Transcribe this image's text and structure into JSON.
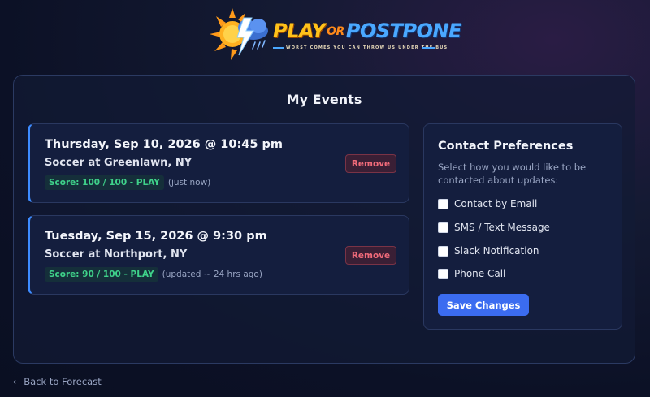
{
  "logo": {
    "play": "PLAY",
    "or": "OR",
    "postpone": "POSTPONE",
    "tagline": "WORST COMES YOU CAN THROW US UNDER THE BUS",
    "icon": "sun-storm-cloud-icon"
  },
  "page": {
    "title": "My Events"
  },
  "events": [
    {
      "date": "Thursday, Sep 10, 2026 @ 10:45 pm",
      "location": "Soccer at Greenlawn, NY",
      "score": "Score: 100 / 100 - PLAY",
      "updated": "(just now)",
      "remove_label": "Remove"
    },
    {
      "date": "Tuesday, Sep 15, 2026 @ 9:30 pm",
      "location": "Soccer at Northport, NY",
      "score": "Score: 90 / 100 - PLAY",
      "updated": "(updated ~ 24 hrs ago)",
      "remove_label": "Remove"
    }
  ],
  "contact": {
    "title": "Contact Preferences",
    "description": "Select how you would like to be contacted about updates:",
    "options": [
      {
        "label": "Contact by Email",
        "checked": false
      },
      {
        "label": "SMS / Text Message",
        "checked": false
      },
      {
        "label": "Slack Notification",
        "checked": false
      },
      {
        "label": "Phone Call",
        "checked": false
      }
    ],
    "save_label": "Save Changes"
  },
  "footer": {
    "back_label": "← Back to Forecast"
  },
  "colors": {
    "accent": "#3b6cf0",
    "score_green": "#3fd28a",
    "remove_red": "#f06b7a",
    "event_border": "#3d8bff"
  }
}
